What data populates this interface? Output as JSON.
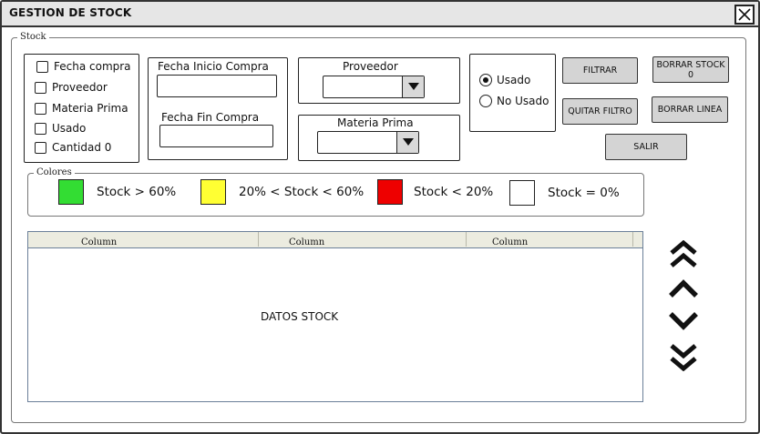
{
  "window": {
    "title": "GESTION DE STOCK"
  },
  "stock_group": {
    "legend": "Stock",
    "checkboxes": [
      {
        "label": "Fecha compra",
        "checked": false
      },
      {
        "label": "Proveedor",
        "checked": false
      },
      {
        "label": "Materia Prima",
        "checked": false
      },
      {
        "label": "Usado",
        "checked": false
      },
      {
        "label": "Cantidad 0",
        "checked": false
      }
    ],
    "fecha_inicio_label": "Fecha Inicio Compra",
    "fecha_inicio_value": "",
    "fecha_fin_label": "Fecha Fin Compra",
    "fecha_fin_value": "",
    "proveedor_label": "Proveedor",
    "proveedor_value": "",
    "materia_prima_label": "Materia Prima",
    "materia_prima_value": "",
    "radios": [
      {
        "label": "Usado",
        "selected": true
      },
      {
        "label": "No Usado",
        "selected": false
      }
    ],
    "buttons": {
      "filtrar": "FILTRAR",
      "borrar_stock": "BORRAR STOCK 0",
      "quitar_filtro": "QUITAR FILTRO",
      "borrar_linea": "BORRAR LINEA",
      "salir": "SALIR"
    }
  },
  "colores_group": {
    "legend": "Colores",
    "items": [
      {
        "label": "Stock > 60%",
        "color": "#33dd33"
      },
      {
        "label": "20% < Stock < 60%",
        "color": "#ffff33"
      },
      {
        "label": "Stock < 20%",
        "color": "#ee0000"
      },
      {
        "label": "Stock = 0%",
        "color": "#ffffff"
      }
    ]
  },
  "table": {
    "columns": [
      "Column",
      "Column",
      "Column"
    ],
    "placeholder": "DATOS STOCK"
  },
  "nav": [
    "double-chevron-up-icon",
    "chevron-up-icon",
    "chevron-down-icon",
    "double-chevron-down-icon"
  ]
}
